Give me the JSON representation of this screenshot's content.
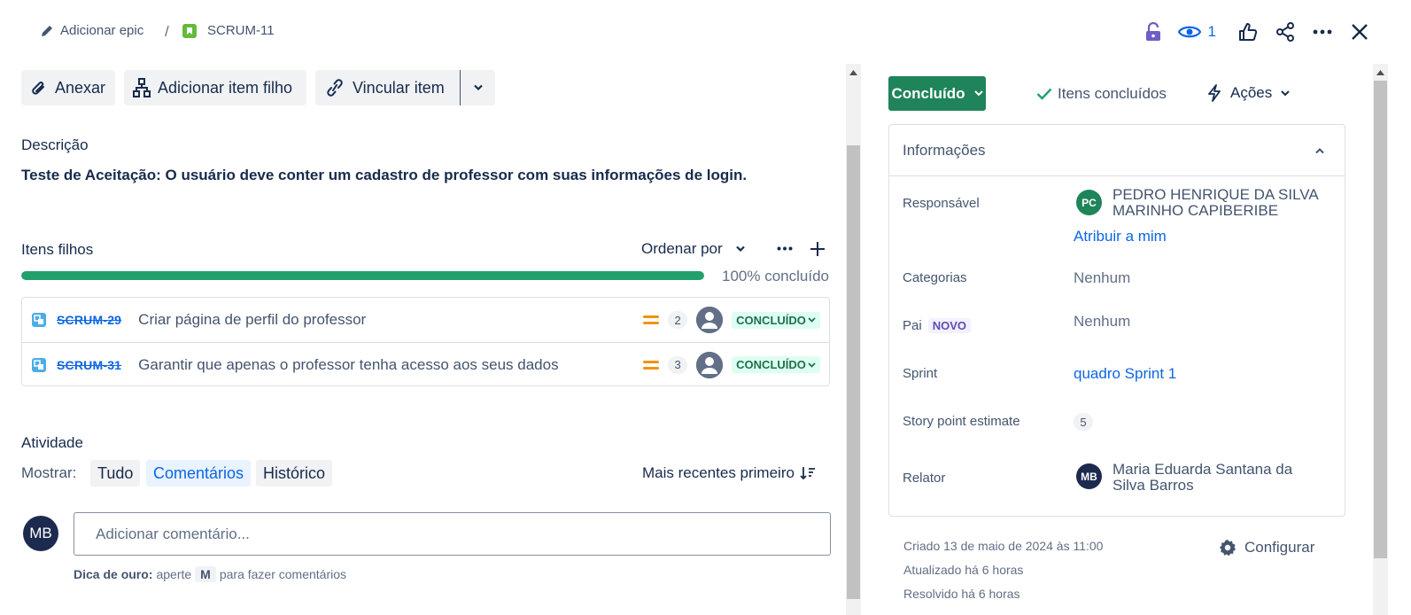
{
  "breadcrumb": {
    "add_epic": "Adicionar epic",
    "separator": "/",
    "issue_key": "SCRUM-11"
  },
  "top_actions": {
    "watch_count": "1"
  },
  "toolbar": {
    "attach": "Anexar",
    "add_child": "Adicionar item filho",
    "link_item": "Vincular item"
  },
  "description": {
    "label": "Descrição",
    "text": "Teste de Aceitação: O usuário deve conter um cadastro de professor com suas informações de login."
  },
  "child_items": {
    "label": "Itens filhos",
    "sort_label": "Ordenar por",
    "progress_percent": 100,
    "progress_text": "100% concluído",
    "rows": [
      {
        "key": "SCRUM-29",
        "summary": "Criar página de perfil do professor",
        "points": "2",
        "status": "CONCLUÍDO"
      },
      {
        "key": "SCRUM-31",
        "summary": "Garantir que apenas o professor tenha acesso aos seus dados",
        "points": "3",
        "status": "CONCLUÍDO"
      }
    ]
  },
  "activity": {
    "label": "Atividade",
    "show_label": "Mostrar:",
    "filters": [
      "Tudo",
      "Comentários",
      "Histórico"
    ],
    "active_filter": "Comentários",
    "sort": "Mais recentes primeiro",
    "current_user_initials": "MB",
    "comment_placeholder": "Adicionar comentário...",
    "tip_bold": "Dica de ouro:",
    "tip_pre": "aperte",
    "tip_key": "M",
    "tip_post": "para fazer comentários"
  },
  "status_bar": {
    "status": "Concluído",
    "resolution": "Itens concluídos",
    "actions": "Ações"
  },
  "info_panel": {
    "title": "Informações",
    "assignee_label": "Responsável",
    "assignee_initials": "PC",
    "assignee_name_line1": "PEDRO HENRIQUE DA SILVA",
    "assignee_name_line2": "MARINHO CAPIBERIBE",
    "assign_to_me": "Atribuir a mim",
    "categories_label": "Categorias",
    "categories_value": "Nenhum",
    "parent_label": "Pai",
    "parent_badge": "NOVO",
    "parent_value": "Nenhum",
    "sprint_label": "Sprint",
    "sprint_value": "quadro Sprint 1",
    "story_points_label": "Story point estimate",
    "story_points_value": "5",
    "reporter_label": "Relator",
    "reporter_initials": "MB",
    "reporter_name_line1": "Maria Eduarda Santana da",
    "reporter_name_line2": "Silva Barros"
  },
  "meta": {
    "created": "Criado 13 de maio de 2024 às 11:00",
    "updated": "Atualizado há 6 horas",
    "resolved": "Resolvido há 6 horas",
    "configure": "Configurar"
  },
  "colors": {
    "accent_blue": "#0c66e4",
    "status_green": "#1f845a",
    "progress_green": "#22a06b",
    "priority_orange": "#f79009"
  }
}
